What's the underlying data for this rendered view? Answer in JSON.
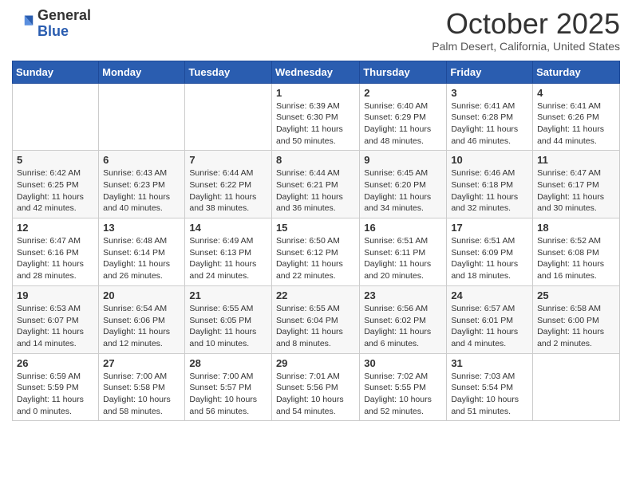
{
  "header": {
    "logo_general": "General",
    "logo_blue": "Blue",
    "month_title": "October 2025",
    "location": "Palm Desert, California, United States"
  },
  "days_of_week": [
    "Sunday",
    "Monday",
    "Tuesday",
    "Wednesday",
    "Thursday",
    "Friday",
    "Saturday"
  ],
  "weeks": [
    [
      {
        "num": "",
        "info": ""
      },
      {
        "num": "",
        "info": ""
      },
      {
        "num": "",
        "info": ""
      },
      {
        "num": "1",
        "info": "Sunrise: 6:39 AM\nSunset: 6:30 PM\nDaylight: 11 hours and 50 minutes."
      },
      {
        "num": "2",
        "info": "Sunrise: 6:40 AM\nSunset: 6:29 PM\nDaylight: 11 hours and 48 minutes."
      },
      {
        "num": "3",
        "info": "Sunrise: 6:41 AM\nSunset: 6:28 PM\nDaylight: 11 hours and 46 minutes."
      },
      {
        "num": "4",
        "info": "Sunrise: 6:41 AM\nSunset: 6:26 PM\nDaylight: 11 hours and 44 minutes."
      }
    ],
    [
      {
        "num": "5",
        "info": "Sunrise: 6:42 AM\nSunset: 6:25 PM\nDaylight: 11 hours and 42 minutes."
      },
      {
        "num": "6",
        "info": "Sunrise: 6:43 AM\nSunset: 6:23 PM\nDaylight: 11 hours and 40 minutes."
      },
      {
        "num": "7",
        "info": "Sunrise: 6:44 AM\nSunset: 6:22 PM\nDaylight: 11 hours and 38 minutes."
      },
      {
        "num": "8",
        "info": "Sunrise: 6:44 AM\nSunset: 6:21 PM\nDaylight: 11 hours and 36 minutes."
      },
      {
        "num": "9",
        "info": "Sunrise: 6:45 AM\nSunset: 6:20 PM\nDaylight: 11 hours and 34 minutes."
      },
      {
        "num": "10",
        "info": "Sunrise: 6:46 AM\nSunset: 6:18 PM\nDaylight: 11 hours and 32 minutes."
      },
      {
        "num": "11",
        "info": "Sunrise: 6:47 AM\nSunset: 6:17 PM\nDaylight: 11 hours and 30 minutes."
      }
    ],
    [
      {
        "num": "12",
        "info": "Sunrise: 6:47 AM\nSunset: 6:16 PM\nDaylight: 11 hours and 28 minutes."
      },
      {
        "num": "13",
        "info": "Sunrise: 6:48 AM\nSunset: 6:14 PM\nDaylight: 11 hours and 26 minutes."
      },
      {
        "num": "14",
        "info": "Sunrise: 6:49 AM\nSunset: 6:13 PM\nDaylight: 11 hours and 24 minutes."
      },
      {
        "num": "15",
        "info": "Sunrise: 6:50 AM\nSunset: 6:12 PM\nDaylight: 11 hours and 22 minutes."
      },
      {
        "num": "16",
        "info": "Sunrise: 6:51 AM\nSunset: 6:11 PM\nDaylight: 11 hours and 20 minutes."
      },
      {
        "num": "17",
        "info": "Sunrise: 6:51 AM\nSunset: 6:09 PM\nDaylight: 11 hours and 18 minutes."
      },
      {
        "num": "18",
        "info": "Sunrise: 6:52 AM\nSunset: 6:08 PM\nDaylight: 11 hours and 16 minutes."
      }
    ],
    [
      {
        "num": "19",
        "info": "Sunrise: 6:53 AM\nSunset: 6:07 PM\nDaylight: 11 hours and 14 minutes."
      },
      {
        "num": "20",
        "info": "Sunrise: 6:54 AM\nSunset: 6:06 PM\nDaylight: 11 hours and 12 minutes."
      },
      {
        "num": "21",
        "info": "Sunrise: 6:55 AM\nSunset: 6:05 PM\nDaylight: 11 hours and 10 minutes."
      },
      {
        "num": "22",
        "info": "Sunrise: 6:55 AM\nSunset: 6:04 PM\nDaylight: 11 hours and 8 minutes."
      },
      {
        "num": "23",
        "info": "Sunrise: 6:56 AM\nSunset: 6:02 PM\nDaylight: 11 hours and 6 minutes."
      },
      {
        "num": "24",
        "info": "Sunrise: 6:57 AM\nSunset: 6:01 PM\nDaylight: 11 hours and 4 minutes."
      },
      {
        "num": "25",
        "info": "Sunrise: 6:58 AM\nSunset: 6:00 PM\nDaylight: 11 hours and 2 minutes."
      }
    ],
    [
      {
        "num": "26",
        "info": "Sunrise: 6:59 AM\nSunset: 5:59 PM\nDaylight: 11 hours and 0 minutes."
      },
      {
        "num": "27",
        "info": "Sunrise: 7:00 AM\nSunset: 5:58 PM\nDaylight: 10 hours and 58 minutes."
      },
      {
        "num": "28",
        "info": "Sunrise: 7:00 AM\nSunset: 5:57 PM\nDaylight: 10 hours and 56 minutes."
      },
      {
        "num": "29",
        "info": "Sunrise: 7:01 AM\nSunset: 5:56 PM\nDaylight: 10 hours and 54 minutes."
      },
      {
        "num": "30",
        "info": "Sunrise: 7:02 AM\nSunset: 5:55 PM\nDaylight: 10 hours and 52 minutes."
      },
      {
        "num": "31",
        "info": "Sunrise: 7:03 AM\nSunset: 5:54 PM\nDaylight: 10 hours and 51 minutes."
      },
      {
        "num": "",
        "info": ""
      }
    ]
  ]
}
